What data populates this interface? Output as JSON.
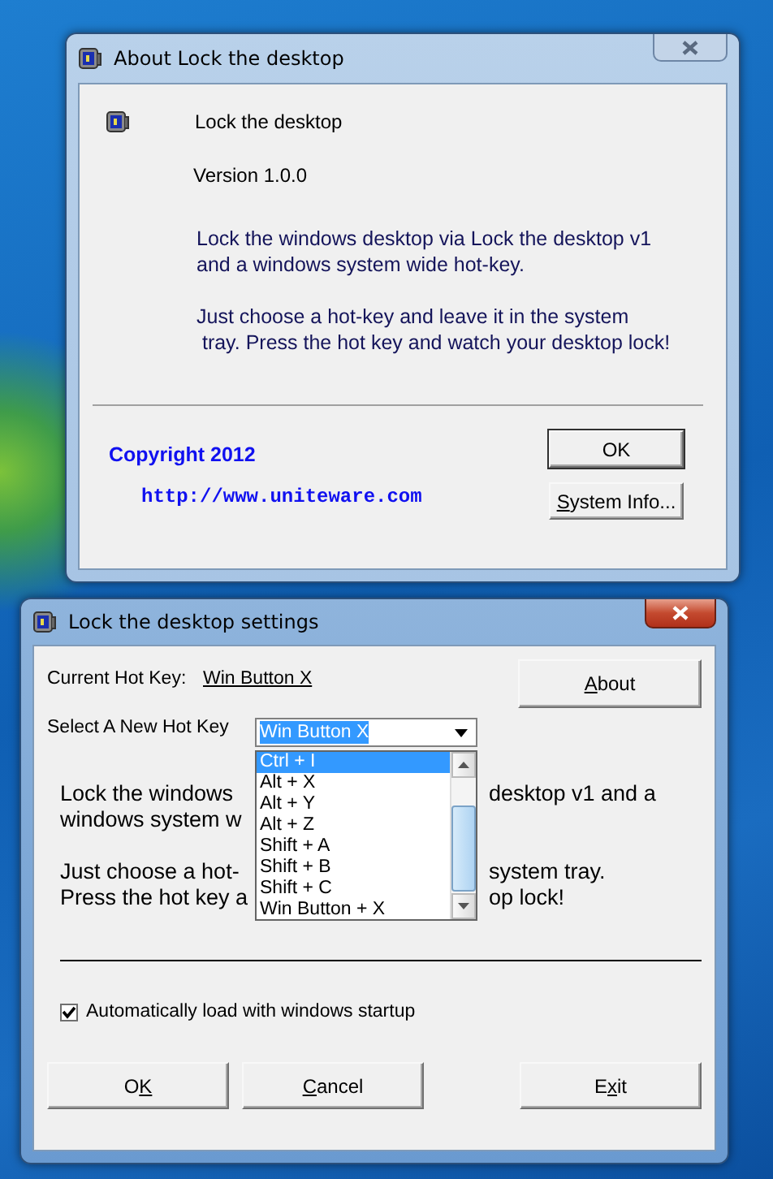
{
  "about_dialog": {
    "title": "About Lock the desktop",
    "active": false,
    "app_name": "Lock the desktop",
    "version": "Version 1.0.0",
    "description": [
      [
        "Lock the windows desktop via Lock the desktop v1",
        "and a windows system wide hot-key."
      ],
      [
        "Just choose a hot-key and leave it in the system",
        " tray. Press the hot key and watch your desktop lock!"
      ]
    ],
    "copyright": "Copyright 2012",
    "link": "http://www.uniteware.com",
    "buttons": [
      {
        "label": {
          "before": "OK"
        }
      },
      {
        "label": {
          "key": "S",
          "after": "ystem Info..."
        }
      }
    ]
  },
  "settings_dialog": {
    "title": "Lock the desktop settings",
    "active": true,
    "current_label": "Current Hot Key:",
    "current_value": "Win Button X",
    "about_button": {
      "label": {
        "key": "A",
        "after": "bout"
      }
    },
    "select_label": "Select A New Hot Key",
    "select_value": "Win Button X",
    "options": [
      {
        "label": "Ctrl + I",
        "selected": true
      },
      {
        "label": "Alt + X",
        "selected": false
      },
      {
        "label": "Alt + Y",
        "selected": false
      },
      {
        "label": "Alt + Z",
        "selected": false
      },
      {
        "label": "Shift + A",
        "selected": false
      },
      {
        "label": "Shift + B",
        "selected": false
      },
      {
        "label": "Shift + C",
        "selected": false
      },
      {
        "label": "Win Button + X",
        "selected": false
      }
    ],
    "description_paragraphs": [
      [
        {
          "left": "Lock the windows",
          "right": "desktop v1 and a"
        },
        {
          "left": "windows system w"
        }
      ],
      [
        {
          "left": "Just choose a hot-",
          "right": "system tray."
        },
        {
          "left": "Press the hot key a",
          "right": "op lock!"
        }
      ]
    ],
    "autoload": {
      "label": "Automatically load with windows startup",
      "checked": true
    },
    "buttons": [
      {
        "label": {
          "before": "O",
          "key": "K"
        }
      },
      {
        "label": {
          "key": "C",
          "after": "ancel"
        }
      },
      {
        "label": {
          "before": "E",
          "key": "x",
          "after": "it"
        }
      }
    ]
  }
}
